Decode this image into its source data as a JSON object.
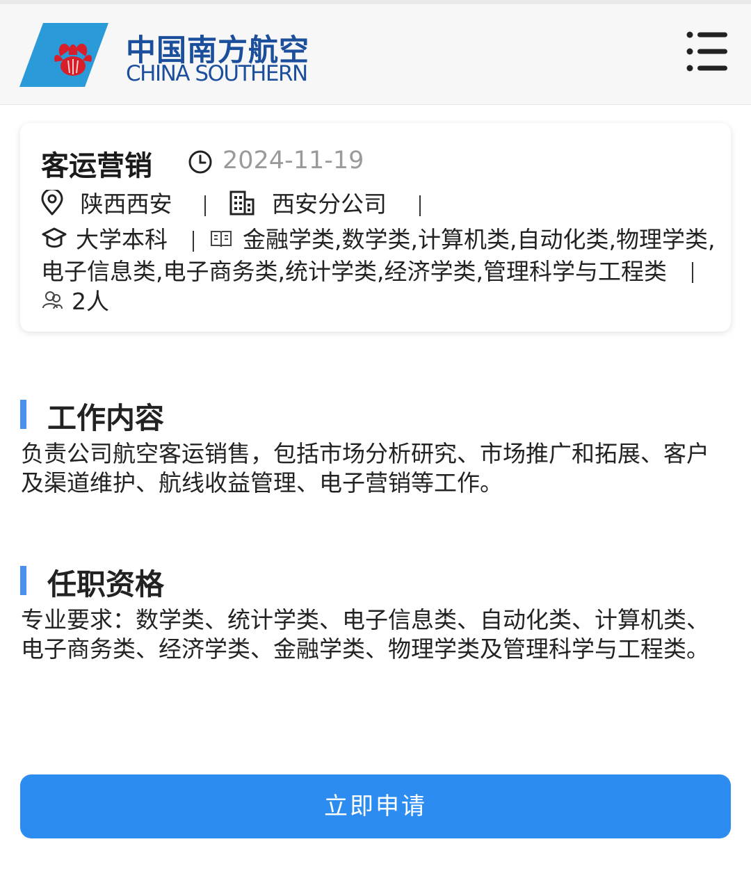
{
  "header": {
    "brand_cn": "中国南方航空",
    "brand_en": "CHINA SOUTHERN",
    "logo_icon": "kapok-flower-logo-icon",
    "menu_icon": "menu-list-icon",
    "brand_color": "#1b4f9c",
    "logo_color": "#2b9ad8"
  },
  "job": {
    "title": "客运营销",
    "date": "2024-11-19",
    "location": "陕西西安",
    "branch": "西安分公司",
    "education": "大学本科",
    "majors": "金融学类,数学类,计算机类,自动化类,物理学类,电子信息类,电子商务类,统计学类,经济学类,管理科学与工程类",
    "headcount": "2人",
    "separator": "|"
  },
  "sections": {
    "duties_title": "工作内容",
    "duties_text": "负责公司航空客运销售，包括市场分析研究、市场推广和拓展、客户及渠道维护、航线收益管理、电子营销等工作。",
    "requirements_title": "任职资格",
    "requirements_text": "专业要求：数学类、统计学类、电子信息类、自动化类、计算机类、电子商务类、经济学类、金融学类、物理学类及管理科学与工程类。"
  },
  "apply_button": "立即申请",
  "colors": {
    "accent": "#4b8ff0",
    "button": "#2d8cf0",
    "date_gray": "#9a9a9a"
  }
}
